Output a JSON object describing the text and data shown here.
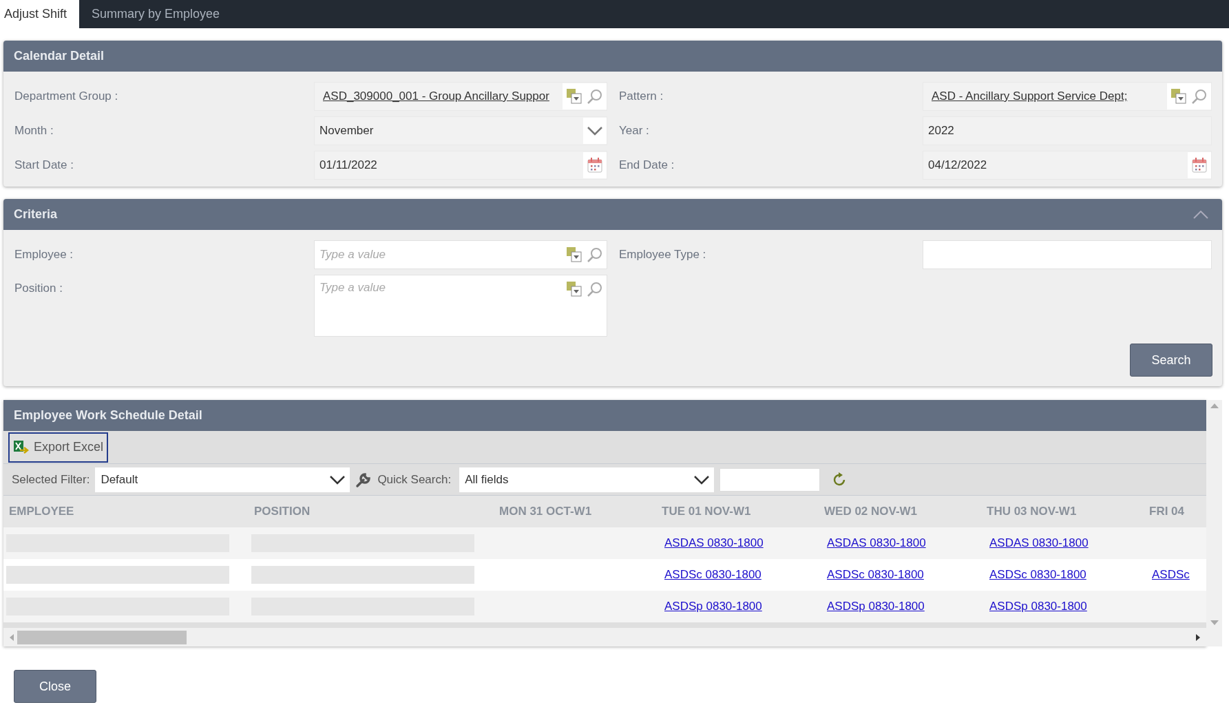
{
  "tabs": [
    {
      "label": "Adjust Shift",
      "selected": true
    },
    {
      "label": "Summary by Employee",
      "selected": false
    }
  ],
  "calendar_detail": {
    "title": "Calendar Detail",
    "fields": [
      {
        "label": "Department Group :",
        "kind": "lookup",
        "value": "ASD_309000_001 - Group Ancillary Suppor"
      },
      {
        "label": "Pattern :",
        "kind": "lookup",
        "value": "ASD - Ancillary Support Service Dept;"
      },
      {
        "label": "Month :",
        "kind": "dropdown",
        "value": "November"
      },
      {
        "label": "Year :",
        "kind": "text",
        "value": "2022"
      },
      {
        "label": "Start Date :",
        "kind": "date",
        "value": "01/11/2022"
      },
      {
        "label": "End Date :",
        "kind": "date",
        "value": "04/12/2022"
      }
    ]
  },
  "criteria": {
    "title": "Criteria",
    "expanded": true,
    "fields": [
      {
        "label": "Employee :",
        "kind": "lookup",
        "placeholder": "Type a value"
      },
      {
        "label": "Employee Type :",
        "kind": "text"
      },
      {
        "label": "Position :",
        "kind": "lookup_multi",
        "placeholder": "Type a value"
      }
    ],
    "search_button": "Search"
  },
  "schedule": {
    "title": "Employee Work Schedule Detail",
    "export_button": "Export Excel",
    "filter_label": "Selected Filter:",
    "filter_value": "Default",
    "quick_search_label": "Quick Search:",
    "quick_search_field": "All fields",
    "columns": [
      "EMPLOYEE",
      "POSITION",
      "MON 31 OCT-W1",
      "TUE 01 NOV-W1",
      "WED 02 NOV-W1",
      "THU 03 NOV-W1",
      "FRI 04"
    ],
    "rows": [
      {
        "tue": "ASDAS 0830-1800",
        "wed": "ASDAS 0830-1800",
        "thu": "ASDAS 0830-1800"
      },
      {
        "tue": "ASDSc 0830-1800",
        "wed": "ASDSc 0830-1800",
        "thu": "ASDSc 0830-1800",
        "fri": "ASDSc"
      },
      {
        "tue": "ASDSp 0830-1800",
        "wed": "ASDSp 0830-1800",
        "thu": "ASDSp 0830-1800"
      }
    ]
  },
  "close_button": "Close"
}
